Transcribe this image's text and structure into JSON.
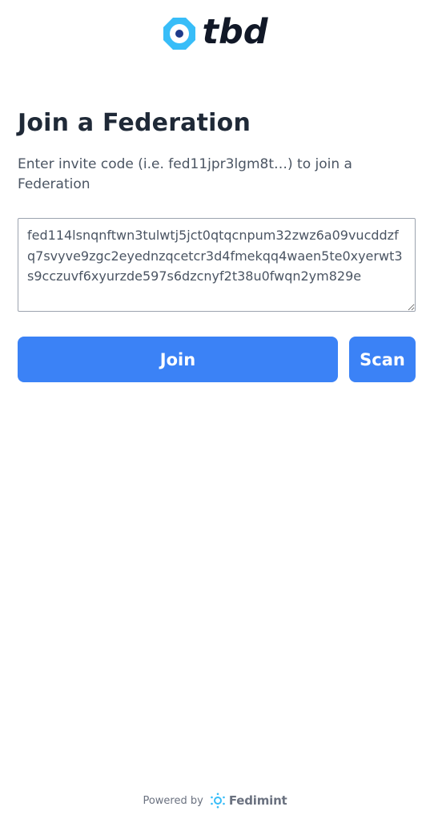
{
  "header": {
    "logo_text": "tbd",
    "logo_color": "#38bdf8"
  },
  "main": {
    "title": "Join a Federation",
    "instructions": "Enter invite code (i.e. fed11jpr3lgm8t…) to join a Federation",
    "invite_value": "fed114lsnqnftwn3tulwtj5jct0qtqcnpum32zwz6a09vucddzfq7svyve9zgc2eyednzqcetcr3d4fmekqq4waen5te0xyerwt3s9cczuvf6xyurzde597s6dzcnyf2t38u0fwqn2ym829e",
    "join_label": "Join",
    "scan_label": "Scan"
  },
  "footer": {
    "powered_by": "Powered by",
    "brand": "Fedimint"
  },
  "colors": {
    "accent": "#3b82f6",
    "text": "#1f2937",
    "muted": "#4b5563"
  }
}
